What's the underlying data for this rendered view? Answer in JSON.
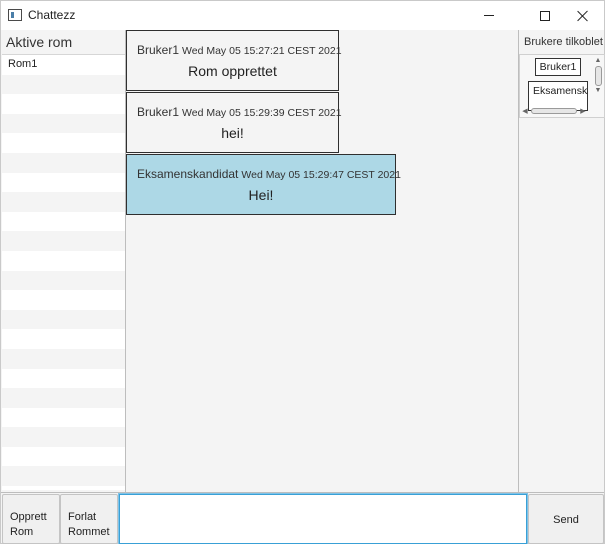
{
  "window": {
    "title": "Chattezz",
    "icons": {
      "app": "chat-window-icon",
      "minimize": "minimize-icon",
      "maximize": "maximize-icon",
      "close": "close-icon"
    }
  },
  "rooms": {
    "title": "Aktive rom",
    "items": [
      "Rom1"
    ]
  },
  "messages": [
    {
      "user": "Bruker1",
      "time": "Wed May 05 15:27:21 CEST 2021",
      "text": "Rom opprettet",
      "own": false
    },
    {
      "user": "Bruker1",
      "time": "Wed May 05 15:29:39 CEST 2021",
      "text": "hei!",
      "own": false
    },
    {
      "user": "Eksamenskandidat",
      "time": "Wed May 05 15:29:47 CEST 2021",
      "text": "Hei!",
      "own": true
    }
  ],
  "users": {
    "title": "Brukere tilkoblet",
    "items": [
      "Bruker1",
      "Eksamenskandidat"
    ]
  },
  "bottom": {
    "create_room_label": "Opprett Rom",
    "leave_room_label": "Forlat Rommet",
    "message_input_value": "",
    "send_label": "Send"
  },
  "colors": {
    "own_message_background": "#add8e6",
    "message_background": "#f4f4f4",
    "input_focus_border": "#39a0d6"
  }
}
